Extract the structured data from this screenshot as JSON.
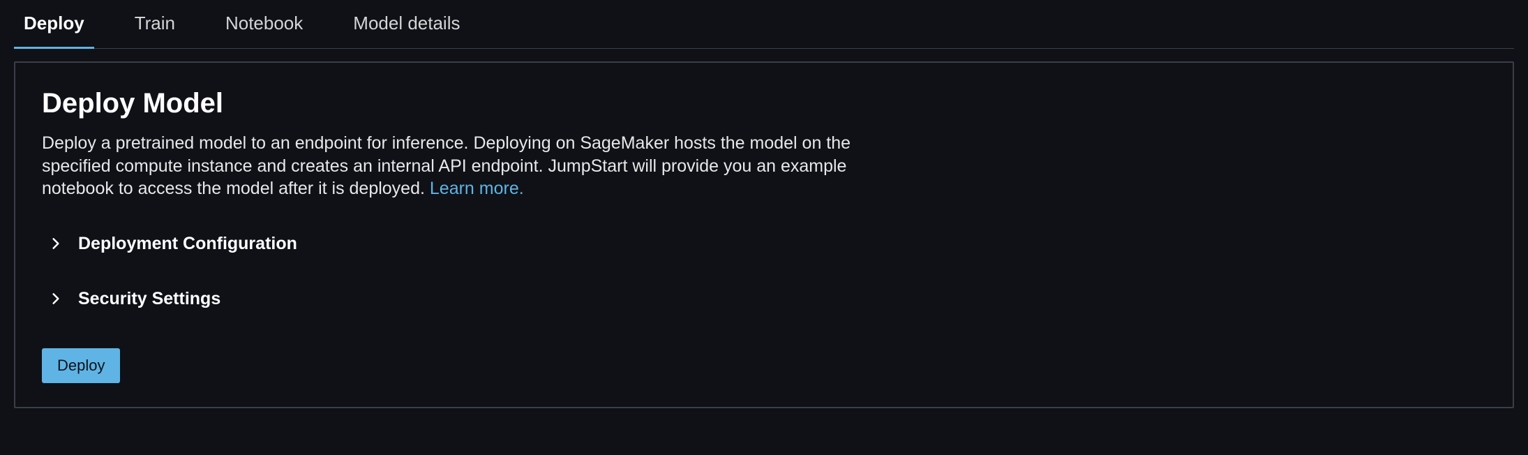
{
  "tabs": {
    "deploy": "Deploy",
    "train": "Train",
    "notebook": "Notebook",
    "model_details": "Model details"
  },
  "panel": {
    "title": "Deploy Model",
    "description": "Deploy a pretrained model to an endpoint for inference. Deploying on SageMaker hosts the model on the specified compute instance and creates an internal API endpoint. JumpStart will provide you an example notebook to access the model after it is deployed. ",
    "learn_more": "Learn more."
  },
  "sections": {
    "deployment_config": "Deployment Configuration",
    "security_settings": "Security Settings"
  },
  "buttons": {
    "deploy": "Deploy"
  }
}
